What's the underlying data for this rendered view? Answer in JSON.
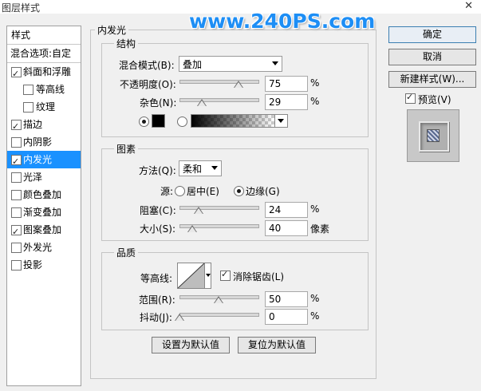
{
  "window": {
    "title": "图层样式",
    "close_glyph": "✕"
  },
  "watermark": "www.240PS.com",
  "left_panel": {
    "header": "样式",
    "blend_options": "混合选项:自定",
    "items": [
      {
        "label": "斜面和浮雕",
        "checked": true,
        "indent": false
      },
      {
        "label": "等高线",
        "checked": false,
        "indent": true
      },
      {
        "label": "纹理",
        "checked": false,
        "indent": true
      },
      {
        "label": "描边",
        "checked": true,
        "indent": false
      },
      {
        "label": "内阴影",
        "checked": false,
        "indent": false
      },
      {
        "label": "内发光",
        "checked": true,
        "indent": false,
        "selected": true
      },
      {
        "label": "光泽",
        "checked": false,
        "indent": false
      },
      {
        "label": "颜色叠加",
        "checked": false,
        "indent": false
      },
      {
        "label": "渐变叠加",
        "checked": false,
        "indent": false
      },
      {
        "label": "图案叠加",
        "checked": true,
        "indent": false
      },
      {
        "label": "外发光",
        "checked": false,
        "indent": false
      },
      {
        "label": "投影",
        "checked": false,
        "indent": false
      }
    ]
  },
  "main": {
    "section_title": "内发光",
    "structure": {
      "title": "结构",
      "blend_mode_label": "混合模式(B):",
      "blend_mode_value": "叠加",
      "opacity_label": "不透明度(O):",
      "opacity_value": "75",
      "opacity_level": 75,
      "noise_label": "杂色(N):",
      "noise_value": "29",
      "noise_level": 29,
      "percent": "%"
    },
    "elements": {
      "title": "图素",
      "method_label": "方法(Q):",
      "method_value": "柔和",
      "source_label": "源:",
      "source_center": "居中(E)",
      "source_edge": "边缘(G)",
      "choke_label": "阻塞(C):",
      "choke_value": "24",
      "choke_level": 24,
      "size_label": "大小(S):",
      "size_value": "40",
      "size_unit": "像素",
      "size_level": 16,
      "percent": "%"
    },
    "quality": {
      "title": "品质",
      "contour_label": "等高线:",
      "antialias_label": "消除锯齿(L)",
      "range_label": "范围(R):",
      "range_value": "50",
      "range_level": 50,
      "jitter_label": "抖动(J):",
      "jitter_value": "0",
      "jitter_level": 0,
      "percent": "%"
    },
    "set_default": "设置为默认值",
    "reset_default": "复位为默认值"
  },
  "right": {
    "ok": "确定",
    "cancel": "取消",
    "new_style": "新建样式(W)...",
    "preview_label": "预览(V)"
  }
}
